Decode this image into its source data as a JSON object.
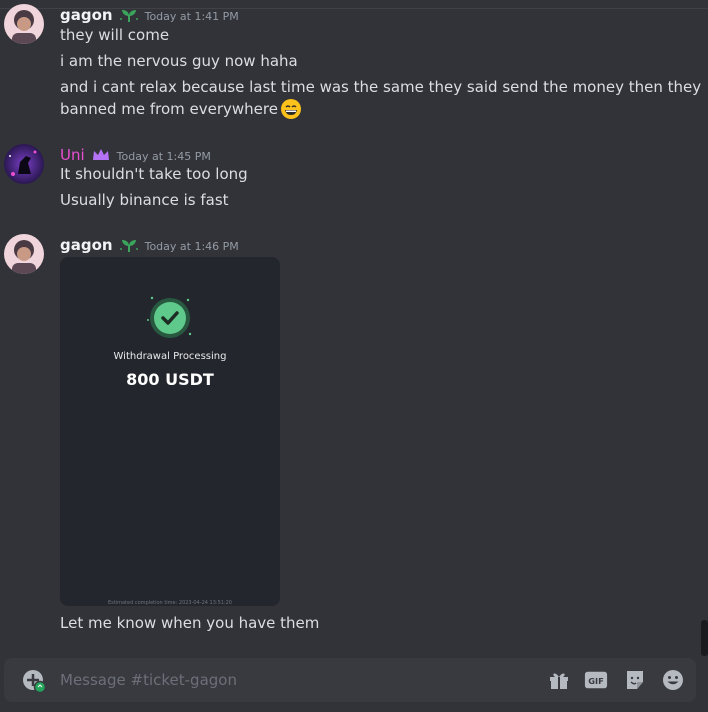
{
  "messages": [
    {
      "author": "gagon",
      "timestamp": "Today at 1:41 PM",
      "lines": [
        "they will come",
        "i am the nervous guy now haha",
        "and i cant relax because last time was the same they said send the money then they",
        "banned me from everywhere"
      ],
      "trailing_emoji": "smiling-face-emoji"
    },
    {
      "author": "Uni",
      "timestamp": "Today at 1:45 PM",
      "lines": [
        "It shouldn't take too long",
        "Usually binance is fast"
      ]
    },
    {
      "author": "gagon",
      "timestamp": "Today at 1:46 PM",
      "attachment": {
        "title": "Withdrawal Processing",
        "amount": "800 USDT",
        "footer": "Estimated completion time: 2023-04-24 13:51:20"
      },
      "lines": [
        "Let me know when you have them"
      ]
    }
  ],
  "composer": {
    "placeholder": "Message #ticket-gagon",
    "gif_label": "GIF"
  },
  "colors": {
    "background": "#323339",
    "composer": "#383a40",
    "uni_name": "#e84fd1",
    "badge_green": "#3ba55c",
    "crown": "#b473f5"
  }
}
